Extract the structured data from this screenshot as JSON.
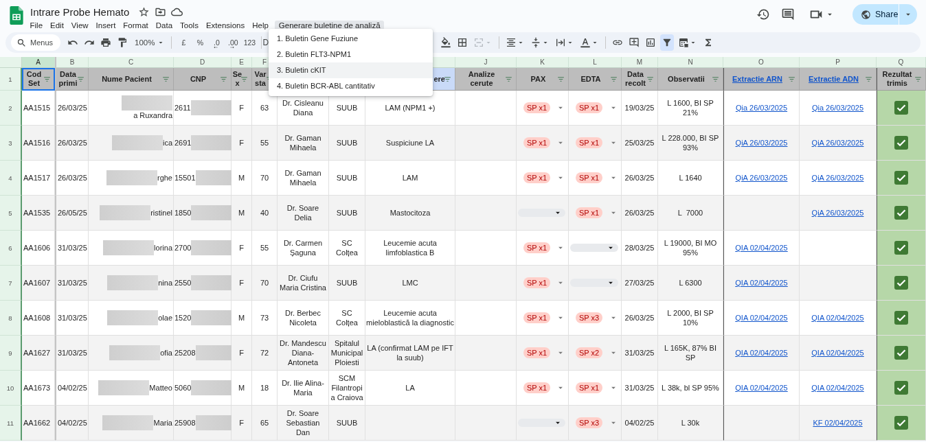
{
  "document": {
    "title": "Intrare Probe Hemato"
  },
  "menu_bar": [
    {
      "label": "File",
      "open": false
    },
    {
      "label": "Edit",
      "open": false
    },
    {
      "label": "View",
      "open": false
    },
    {
      "label": "Insert",
      "open": false
    },
    {
      "label": "Format",
      "open": false
    },
    {
      "label": "Data",
      "open": false
    },
    {
      "label": "Tools",
      "open": false
    },
    {
      "label": "Extensions",
      "open": false
    },
    {
      "label": "Help",
      "open": false
    },
    {
      "label": "Generare buletine de analiză",
      "open": true
    }
  ],
  "open_menu": [
    {
      "label": "1. Buletin Gene Fuziune",
      "selected": false
    },
    {
      "label": "2. Buletin FLT3-NPM1",
      "selected": false
    },
    {
      "label": "3. Buletin cKIT",
      "selected": true
    },
    {
      "label": "4. Buletin BCR-ABL cantitativ",
      "selected": false
    }
  ],
  "share_button": {
    "label": "Share"
  },
  "toolbar": {
    "search": {
      "placeholder": "Menus"
    },
    "zoom": "100%",
    "format_buttons": [
      "£",
      "%",
      ".0",
      ".00",
      "123"
    ],
    "font_partial": "D",
    "filter_selected": true
  },
  "columns": [
    {
      "letter": "A",
      "header": "Cod Set",
      "kind": "text",
      "selected": true,
      "highlighted": false
    },
    {
      "letter": "B",
      "header": "Data primi",
      "kind": "text",
      "selected": false,
      "highlighted": false
    },
    {
      "letter": "C",
      "header": "Nume Pacient",
      "kind": "text",
      "selected": false,
      "highlighted": false
    },
    {
      "letter": "D",
      "header": "CNP",
      "kind": "text",
      "selected": false,
      "highlighted": false
    },
    {
      "letter": "E",
      "header": "Se x",
      "kind": "text",
      "selected": false,
      "highlighted": false
    },
    {
      "letter": "F",
      "header": "Var sta",
      "kind": "text",
      "selected": false,
      "highlighted": false
    },
    {
      "kind": "covered"
    },
    {
      "kind": "covered"
    },
    {
      "header": "ere",
      "kind": "partial",
      "selected": false,
      "highlighted": true
    },
    {
      "letter": "J",
      "header": "Analize cerute",
      "kind": "text",
      "selected": false,
      "highlighted": false
    },
    {
      "letter": "K",
      "header": "PAX",
      "kind": "text",
      "selected": false,
      "highlighted": false
    },
    {
      "letter": "L",
      "header": "EDTA",
      "kind": "text",
      "selected": false,
      "highlighted": false
    },
    {
      "letter": "M",
      "header": "Data recolt",
      "kind": "text",
      "selected": false,
      "highlighted": false
    },
    {
      "letter": "N",
      "header": "Observatii",
      "kind": "text",
      "selected": false,
      "highlighted": false
    },
    {
      "letter": "O",
      "header": "Extractie ARN",
      "kind": "link",
      "selected": false,
      "highlighted": false
    },
    {
      "letter": "P",
      "header": "Extractie ADN",
      "kind": "link",
      "selected": false,
      "highlighted": false
    },
    {
      "letter": "Q",
      "header": "Rezultat trimis",
      "kind": "text",
      "selected": false,
      "highlighted": false
    }
  ],
  "header_row_number": "1",
  "rows": [
    {
      "number": "2",
      "cod": "AA1515",
      "data_primire": "26/03/25",
      "nume_pacient": "a Ruxandra",
      "cnp": "2611",
      "sex": "F",
      "varsta": "63",
      "medic": "Dr. Cisleanu Diana",
      "spital": "SUUB",
      "diagnostic": "LAM (NPM1 +)",
      "pax": {
        "kind": "chip",
        "text": "SP x1"
      },
      "edta": {
        "kind": "chip",
        "text": "SP x1"
      },
      "data_recolt": "19/03/25",
      "observatii": "L 1600, BI SP 21%",
      "extractie_arn": "Qia 26/03/2025",
      "extractie_adn": "Qia 26/03/2025",
      "checked": true
    },
    {
      "number": "3",
      "cod": "AA1516",
      "data_primire": "26/03/25",
      "nume_pacient": "ica",
      "cnp": "2691",
      "sex": "F",
      "varsta": "55",
      "medic": "Dr. Gaman Mihaela",
      "spital": "SUUB",
      "diagnostic": "Suspiciune LA",
      "pax": {
        "kind": "chip",
        "text": "SP x1"
      },
      "edta": {
        "kind": "chip",
        "text": "SP x1"
      },
      "data_recolt": "25/03/25",
      "observatii": "L 228.000, BI SP 93%",
      "extractie_arn": "QiA 26/03/2025",
      "extractie_adn": "QiA 26/03/2025",
      "checked": true
    },
    {
      "number": "4",
      "cod": "AA1517",
      "data_primire": "26/03/25",
      "nume_pacient": "rghe",
      "cnp": "15501",
      "sex": "M",
      "varsta": "70",
      "medic": "Dr. Gaman Mihaela",
      "spital": "SUUB",
      "diagnostic": "LAM",
      "pax": {
        "kind": "chip",
        "text": "SP x1"
      },
      "edta": {
        "kind": "chip",
        "text": "SP x1"
      },
      "data_recolt": "26/03/25",
      "observatii": "L 1640",
      "extractie_arn": "QiA 26/03/2025",
      "extractie_adn": "QiA 26/03/2025",
      "checked": true
    },
    {
      "number": "5",
      "cod": "AA1535",
      "data_primire": "26/05/25",
      "nume_pacient": "ristinel",
      "cnp": "1850",
      "sex": "M",
      "varsta": "40",
      "medic": "Dr. Soare Delia",
      "spital": "SUUB",
      "diagnostic": "Mastocitoza",
      "pax": {
        "kind": "empty"
      },
      "edta": {
        "kind": "chip",
        "text": "SP x1"
      },
      "data_recolt": "26/03/25",
      "observatii": "L  7000",
      "extractie_adn": "QiA 26/03/2025",
      "checked": true
    },
    {
      "number": "6",
      "cod": "AA1606",
      "data_primire": "31/03/25",
      "nume_pacient": "lorina",
      "cnp": "2700",
      "sex": "F",
      "varsta": "55",
      "medic": "Dr. Carmen Șaguna",
      "spital": "SC Colțea",
      "diagnostic": "Leucemie acuta limfoblastica B",
      "pax": {
        "kind": "chip",
        "text": "SP x1"
      },
      "edta": {
        "kind": "empty"
      },
      "data_recolt": "28/03/25",
      "observatii": "L 19000, BI MO 95%",
      "extractie_arn": "QIA 02/04/2025",
      "checked": true
    },
    {
      "number": "7",
      "cod": "AA1607",
      "data_primire": "31/03/25",
      "nume_pacient": "nina",
      "cnp": "2550",
      "sex": "F",
      "varsta": "70",
      "medic": "Dr. Ciufu Maria Cristina",
      "spital": "SUUB",
      "diagnostic": "LMC",
      "pax": {
        "kind": "chip",
        "text": "SP x1"
      },
      "edta": {
        "kind": "empty"
      },
      "data_recolt": "27/03/25",
      "observatii": "L 6300",
      "extractie_arn": "QIA 02/04/2025",
      "checked": true
    },
    {
      "number": "8",
      "cod": "AA1608",
      "data_primire": "31/03/25",
      "nume_pacient": "olae",
      "cnp": "1520",
      "sex": "M",
      "varsta": "73",
      "medic": "Dr. Berbec Nicoleta",
      "spital": "SC Colțea",
      "diagnostic": "Leucemie acuta mieloblastică la diagnostic",
      "pax": {
        "kind": "chip",
        "text": "SP x1"
      },
      "edta": {
        "kind": "chip",
        "text": "SP x3"
      },
      "data_recolt": "26/03/25",
      "observatii": "L 2000, BI SP 10%",
      "extractie_arn": "QIA 02/04/2025",
      "extractie_adn": "QIA 02/04/2025",
      "checked": true
    },
    {
      "number": "9",
      "cod": "AA1627",
      "data_primire": "31/03/25",
      "nume_pacient": "ofia",
      "cnp": "25208",
      "sex": "F",
      "varsta": "72",
      "medic": "Dr. Mandescu Diana-Antoneta",
      "spital": "Spitalul Municipal Ploiesti",
      "diagnostic": "LA (confirmat LAM pe IFT la suub)",
      "pax": {
        "kind": "chip",
        "text": "SP x1"
      },
      "edta": {
        "kind": "chip",
        "text": "SP x2"
      },
      "data_recolt": "31/03/25",
      "observatii": "L 165K, 87% BI SP",
      "extractie_arn": "QIA 02/04/2025",
      "extractie_adn": "QIA 02/04/2025",
      "checked": true
    },
    {
      "number": "10",
      "cod": "AA1673",
      "data_primire": "04/02/25",
      "nume_pacient": "Matteo",
      "cnp": "5060",
      "sex": "M",
      "varsta": "18",
      "medic": "Dr. Ilie Alina-Maria",
      "spital": "SCM Filantropia Craiova",
      "diagnostic": "LA",
      "pax": {
        "kind": "chip",
        "text": "SP x1"
      },
      "edta": {
        "kind": "chip",
        "text": "SP x1"
      },
      "data_recolt": "31/03/25",
      "observatii": "L 38k, bl SP 95%",
      "extractie_arn": "QIA 02/04/2025",
      "extractie_adn": "QIA 02/04/2025",
      "checked": true
    },
    {
      "number": "11",
      "cod": "AA1662",
      "data_primire": "04/02/25",
      "nume_pacient": "Maria",
      "cnp": "25908",
      "sex": "F",
      "varsta": "65",
      "medic": "Dr. Soare Sebastian Dan",
      "spital": "SUUB",
      "pax": {
        "kind": "empty"
      },
      "edta": {
        "kind": "chip",
        "text": "SP x3"
      },
      "data_recolt": "04/02/25",
      "observatii": "L 30k",
      "extractie_adn": "KF 02/04/2025",
      "checked": true
    }
  ]
}
